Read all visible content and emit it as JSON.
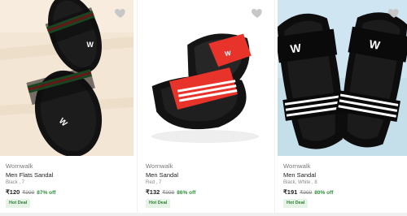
{
  "products": [
    {
      "brand": "Wornwalk",
      "title": "Men Flats Sandal",
      "variant": "Black , 7",
      "price": "₹120",
      "mrp": "₹999",
      "discount": "87% off",
      "badge": "Hot Deal",
      "photo_bg": "#f3e6d4",
      "strap_colors": [
        "#000000",
        "#2e8b3a",
        "#d62828"
      ]
    },
    {
      "brand": "Wornwalk",
      "title": "Men Sandal",
      "variant": "Red , 7",
      "price": "₹132",
      "mrp": "₹999",
      "discount": "86% off",
      "badge": "Hot Deal",
      "photo_bg": "#ffffff",
      "strap_colors": [
        "#e8332a",
        "#ffffff",
        "#111111"
      ]
    },
    {
      "brand": "Wornwalk",
      "title": "Men Sandal",
      "variant": "Black, White , 8",
      "price": "₹191",
      "mrp": "₹999",
      "discount": "80% off",
      "badge": "Hot Deal",
      "photo_bg": "#cfe6f2",
      "strap_colors": [
        "#0a0a0a",
        "#ffffff"
      ]
    }
  ],
  "icons": {
    "wishlist": "heart-icon"
  },
  "colors": {
    "discount_green": "#2e8f3a",
    "badge_bg": "#e6f4e8"
  }
}
